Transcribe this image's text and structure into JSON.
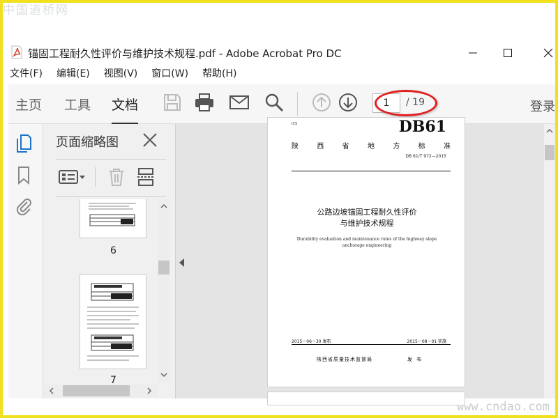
{
  "watermarks": {
    "top": "中国道桥网",
    "bottom": "www.cndao.com"
  },
  "window": {
    "title": "锚固工程耐久性评价与维护技术规程.pdf - Adobe Acrobat Pro DC",
    "icon": "pdf-file-icon"
  },
  "menu": [
    "文件(F)",
    "编辑(E)",
    "视图(V)",
    "窗口(W)",
    "帮助(H)"
  ],
  "toolbar": {
    "tabs": [
      "主页",
      "工具",
      "文档"
    ],
    "active_tab": "文档",
    "icons": [
      "save-icon",
      "print-icon",
      "email-icon",
      "search-icon",
      "page-up-icon",
      "page-down-icon"
    ],
    "page_current": "1",
    "page_total": "/ 19",
    "login": "登录",
    "highlight_color": "#e02020"
  },
  "left_rail": {
    "icons": [
      "page-thumbnails-icon",
      "bookmark-icon",
      "attachment-icon"
    ]
  },
  "thumbnails_panel": {
    "title": "页面缩略图",
    "pages": [
      "6",
      "7"
    ]
  },
  "document": {
    "db_label": "DB61",
    "province_chars": [
      "陕",
      "西",
      "省",
      "地",
      "方",
      "标",
      "准"
    ],
    "standard_no": "DB 61/T 972—2015",
    "title_line1": "公路边坡锚固工程耐久性评价",
    "title_line2": "与维护技术规程",
    "english_title": "Durability evaluation and maintenance rules of the highway slope anchorage engineering",
    "release_date": "2015－06－30 发布",
    "implement_date": "2015－08－01 实施",
    "issuer": "陕西省质量技术监督局",
    "issue_word": "发 布"
  }
}
